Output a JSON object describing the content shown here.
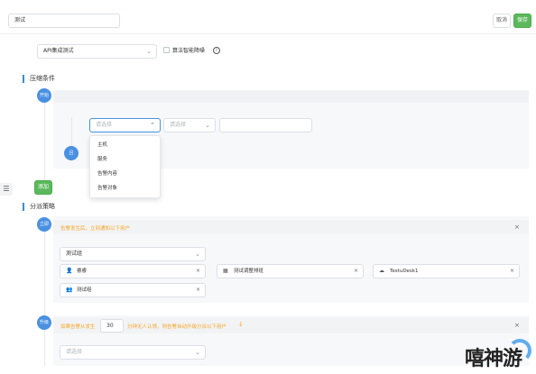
{
  "header": {
    "name_value": "测试",
    "cancel_label": "取消",
    "save_label": "保存"
  },
  "config": {
    "integration_select": "API集成测试",
    "algorithm_checkbox_label": "算法智能降噪",
    "info_icon": "info-icon"
  },
  "compress": {
    "section_title": "压缩条件",
    "start_badge": "开始",
    "and_badge": "且",
    "field_select_placeholder": "请选择",
    "operator_select_placeholder": "请选择",
    "value_input": "",
    "dropdown_options": [
      "主机",
      "服务",
      "告警内容",
      "告警对象"
    ],
    "add_button": "添加"
  },
  "dispatch": {
    "section_title": "分派策略",
    "immediate_badge": "立即",
    "immediate_text": "告警发生后，立刻通知以下用户",
    "group_select": "测试组",
    "recipients": [
      {
        "icon": "user-icon",
        "label": "睿睿"
      },
      {
        "icon": "schedule-icon",
        "label": "测试调整排班"
      },
      {
        "icon": "desk-icon",
        "label": "TestuDesk1"
      },
      {
        "icon": "group-icon",
        "label": "测试组"
      }
    ],
    "escalate_badge": "升级",
    "escalate_prefix": "如果告警从发生",
    "escalate_minutes": "30",
    "escalate_suffix": "分钟无人认领，则告警自动升级分派以下用户",
    "escalate_select_placeholder": "请选择"
  },
  "sidebar": {
    "toggle_icon": "menu-collapse-icon"
  },
  "watermark": {
    "text": "嘻神游",
    "accent": "#3b9ae8"
  },
  "colors": {
    "primary": "#4a90e2",
    "success": "#5cb85c",
    "warning": "#f5a623"
  }
}
